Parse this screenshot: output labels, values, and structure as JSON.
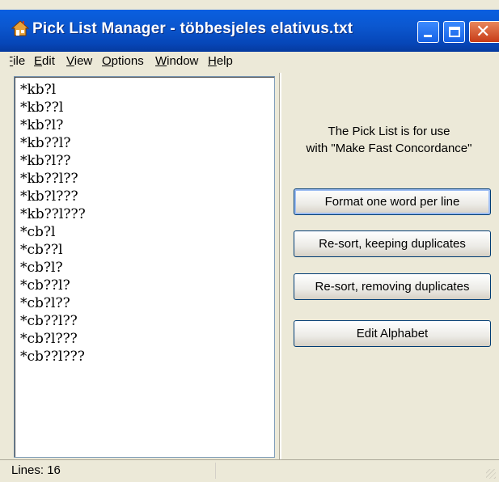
{
  "window": {
    "title": "Pick List Manager - többesjeles elativus.txt",
    "icons": {
      "app": "house-icon",
      "minimize": "minimize-icon",
      "maximize": "maximize-icon",
      "close": "close-icon"
    },
    "close_glyph": "✕"
  },
  "menu": {
    "items": [
      {
        "key": "F",
        "rest": "ile"
      },
      {
        "key": "E",
        "rest": "dit"
      },
      {
        "key": "V",
        "rest": "iew"
      },
      {
        "key": "O",
        "rest": "ptions"
      },
      {
        "key": "W",
        "rest": "indow"
      },
      {
        "key": "H",
        "rest": "elp"
      }
    ]
  },
  "editor": {
    "lines": [
      "*kb?l",
      "*kb??l",
      "*kb?l?",
      "*kb??l?",
      "*kb?l??",
      "*kb??l??",
      "*kb?l???",
      "*kb??l???",
      "*cb?l",
      "*cb??l",
      "*cb?l?",
      "*cb??l?",
      "*cb?l??",
      "*cb??l??",
      "*cb?l???",
      "*cb??l???"
    ]
  },
  "panel": {
    "info_line1": "The Pick List is for use",
    "info_line2": "with \"Make Fast Concordance\"",
    "buttons": {
      "format": "Format one word per line",
      "resort_keep": "Re-sort, keeping duplicates",
      "resort_remove": "Re-sort, removing duplicates",
      "edit_alphabet": "Edit Alphabet"
    }
  },
  "status": {
    "lines": "Lines: 16"
  }
}
